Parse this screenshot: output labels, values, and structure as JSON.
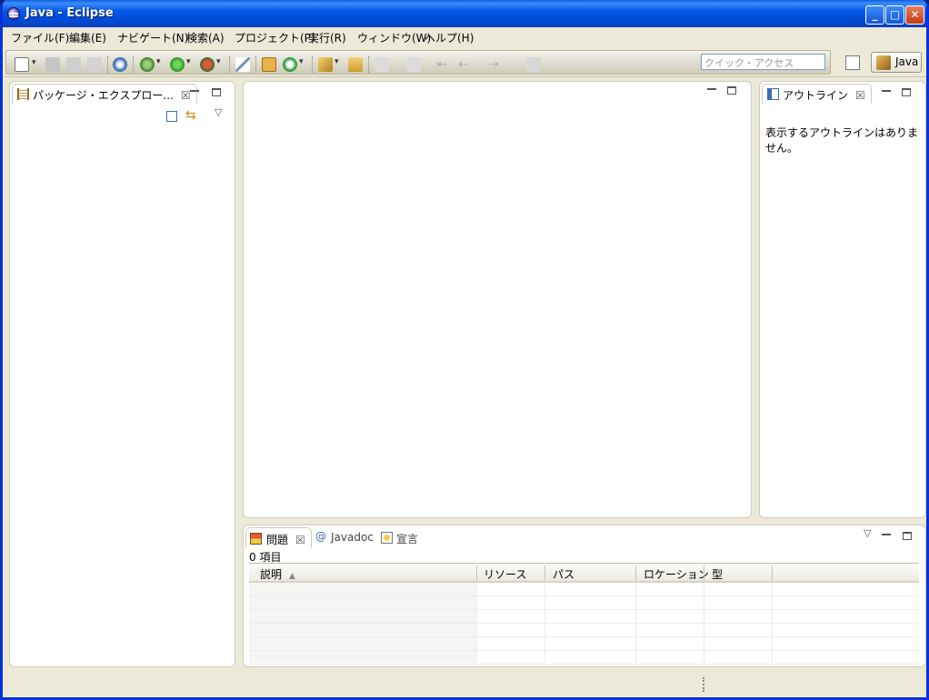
{
  "window": {
    "title": "Java - Eclipse"
  },
  "menu": {
    "items": [
      "ファイル(F)",
      "編集(E)",
      "ナビゲート(N)",
      "検索(A)",
      "プロジェクト(P)",
      "実行(R)",
      "ウィンドウ(W)",
      "ヘルプ(H)"
    ]
  },
  "toolbar": {
    "quick_access_placeholder": "クイック・アクセス",
    "perspective_label": "Java"
  },
  "package_explorer": {
    "tab_label": "パッケージ・エクスプロー..."
  },
  "outline": {
    "tab_label": "アウトライン",
    "empty_message": "表示するアウトラインはありません。"
  },
  "bottom": {
    "tabs": [
      "問題",
      "Javadoc",
      "宣言"
    ],
    "items_count": "0 項目",
    "columns": [
      "説明",
      "リソース",
      "パス",
      "ロケーション",
      "型"
    ]
  },
  "colors": {
    "titlebar": "#0058e6",
    "chrome": "#ece9d8",
    "border_accent": "#0831d9"
  }
}
